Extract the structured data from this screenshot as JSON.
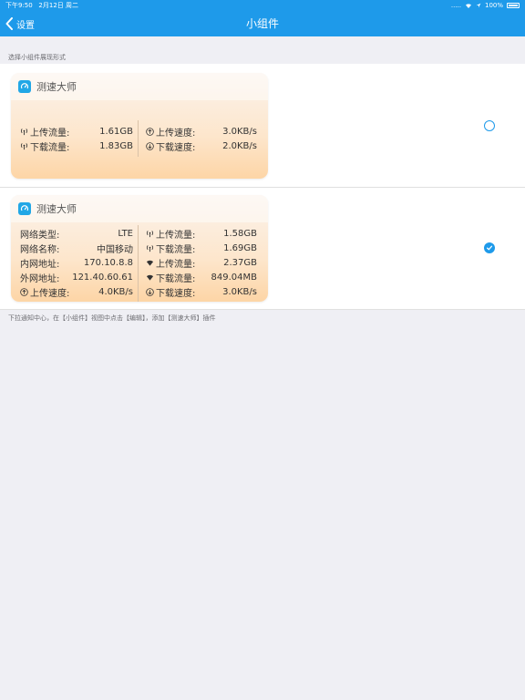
{
  "status_bar": {
    "time": "下午9:50",
    "date": "2月12日 周二",
    "signal": ".....",
    "battery": "100%"
  },
  "nav": {
    "back_label": "设置",
    "title": "小组件"
  },
  "section_header": "选择小组件展现形式",
  "footer_note": "下拉通知中心，在【小组件】视图中点击【编辑】，添加【测速大师】插件",
  "options": [
    {
      "selected": false,
      "app_name": "测速大师",
      "rows": [
        [
          {
            "label": "上传流量:",
            "value": "1.61GB",
            "icon": "cellular-icon"
          },
          {
            "label": "上传速度:",
            "value": "3.0KB/s",
            "icon": "upload-icon"
          }
        ],
        [
          {
            "label": "下载流量:",
            "value": "1.83GB",
            "icon": "cellular-icon"
          },
          {
            "label": "下载速度:",
            "value": "2.0KB/s",
            "icon": "download-icon"
          }
        ]
      ]
    },
    {
      "selected": true,
      "app_name": "测速大师",
      "rows": [
        [
          {
            "label": "网络类型:",
            "value": "LTE",
            "icon": ""
          },
          {
            "label": "上传流量:",
            "value": "1.58GB",
            "icon": "cellular-icon"
          }
        ],
        [
          {
            "label": "网络名称:",
            "value": "中国移动",
            "icon": ""
          },
          {
            "label": "下载流量:",
            "value": "1.69GB",
            "icon": "cellular-icon"
          }
        ],
        [
          {
            "label": "内网地址:",
            "value": "170.10.8.8",
            "icon": ""
          },
          {
            "label": "上传流量:",
            "value": "2.37GB",
            "icon": "wifi-icon"
          }
        ],
        [
          {
            "label": "外网地址:",
            "value": "121.40.60.61",
            "icon": ""
          },
          {
            "label": "下载流量:",
            "value": "849.04MB",
            "icon": "wifi-icon"
          }
        ],
        [
          {
            "label": "上传速度:",
            "value": "4.0KB/s",
            "icon": "upload-icon"
          },
          {
            "label": "下载速度:",
            "value": "3.0KB/s",
            "icon": "download-icon"
          }
        ]
      ]
    }
  ],
  "colors": {
    "accent": "#1e9aea",
    "background": "#efeff4"
  }
}
